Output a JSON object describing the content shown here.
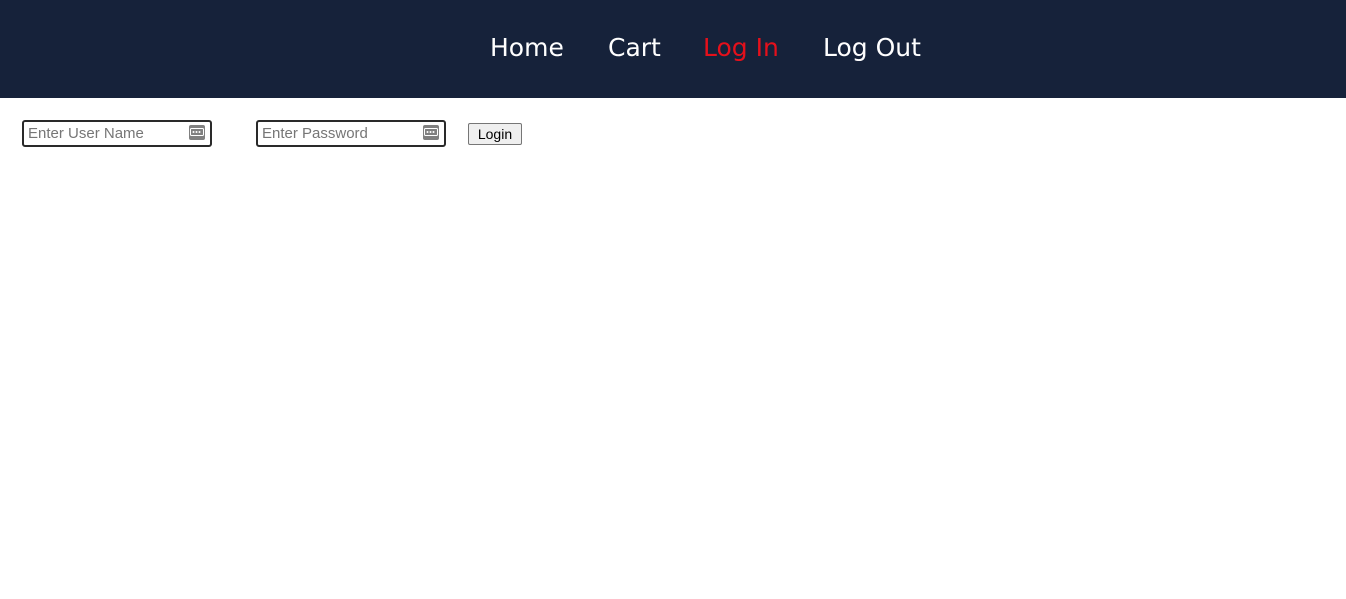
{
  "nav": {
    "links": [
      {
        "label": "Home",
        "active": false
      },
      {
        "label": "Cart",
        "active": false
      },
      {
        "label": "Log In",
        "active": true
      },
      {
        "label": "Log Out",
        "active": false
      }
    ],
    "background": "#16223a",
    "link_color": "#ffffff",
    "active_color": "#e5101b"
  },
  "login_form": {
    "username": {
      "placeholder": "Enter User Name",
      "value": "",
      "icon": "autofill-icon"
    },
    "password": {
      "placeholder": "Enter Password",
      "value": "",
      "icon": "autofill-icon"
    },
    "submit_label": "Login"
  }
}
